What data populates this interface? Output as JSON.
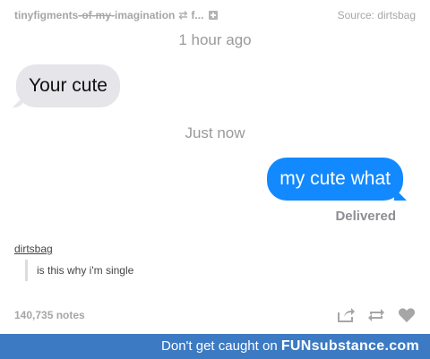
{
  "post": {
    "blog_name_plain": "tinyfigments",
    "blog_name_struck": "-of-my-",
    "blog_name_end": "imagination",
    "reblog_truncated": "f...",
    "source_label": "Source: dirtsbag"
  },
  "conversation": {
    "timestamp_1": "1 hour ago",
    "received_message": "Your cute",
    "timestamp_2": "Just now",
    "sent_message": "my cute what",
    "status": "Delivered",
    "colors": {
      "received_bubble": "#e5e5ea",
      "sent_bubble": "#1289fe"
    }
  },
  "comment": {
    "username": "dirtsbag",
    "text": "is this why i'm single"
  },
  "footer": {
    "notes": "140,735 notes",
    "icons": [
      "share-icon",
      "reblog-icon",
      "like-heart-icon"
    ]
  },
  "banner": {
    "text": "Don't get caught on ",
    "brand": "FUNsubstance.com"
  }
}
